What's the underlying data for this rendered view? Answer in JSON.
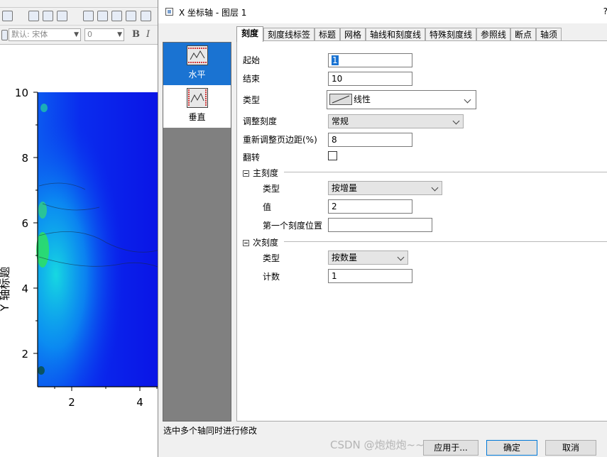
{
  "background_app": {
    "toolbar2": {
      "font_name": "默认: 宋体",
      "font_size": "0",
      "bold_label": "B",
      "italic_label": "I"
    },
    "plot": {
      "y_axis_title": "Y 轴标题",
      "y_ticks": [
        "10",
        "8",
        "6",
        "4",
        "2"
      ],
      "x_ticks": [
        "2",
        "4"
      ]
    }
  },
  "dialog": {
    "title": "X 坐标轴 - 图层 1",
    "help_label": "?",
    "axis_list": [
      {
        "label": "水平",
        "selected": true
      },
      {
        "label": "垂直",
        "selected": false
      }
    ],
    "tabs": [
      {
        "label": "刻度",
        "active": true
      },
      {
        "label": "刻度线标签",
        "active": false
      },
      {
        "label": "标题",
        "active": false
      },
      {
        "label": "网格",
        "active": false
      },
      {
        "label": "轴线和刻度线",
        "active": false
      },
      {
        "label": "特殊刻度线",
        "active": false
      },
      {
        "label": "参照线",
        "active": false
      },
      {
        "label": "断点",
        "active": false
      },
      {
        "label": "轴须",
        "active": false
      }
    ],
    "scale": {
      "from_label": "起始",
      "from_value": "1",
      "to_label": "结束",
      "to_value": "10",
      "type_label": "类型",
      "type_value": "线性",
      "rescale_label": "调整刻度",
      "rescale_value": "常规",
      "margin_label": "重新调整页边距(%)",
      "margin_value": "8",
      "reverse_label": "翻转",
      "reverse_checked": false
    },
    "major_ticks": {
      "header": "主刻度",
      "type_label": "类型",
      "type_value": "按增量",
      "value_label": "值",
      "value_value": "2",
      "first_tick_label": "第一个刻度位置",
      "first_tick_value": ""
    },
    "minor_ticks": {
      "header": "次刻度",
      "type_label": "类型",
      "type_value": "按数量",
      "count_label": "计数",
      "count_value": "1"
    },
    "status_text": "选中多个轴同时进行修改",
    "buttons": {
      "apply": "应用于...",
      "ok": "确定",
      "cancel": "取消"
    }
  },
  "watermark": "CSDN @炮炮炮~~",
  "colors": {
    "selection": "#1a73d2",
    "heatmap_base": "#0a14e6",
    "left_pane": "#808080"
  }
}
